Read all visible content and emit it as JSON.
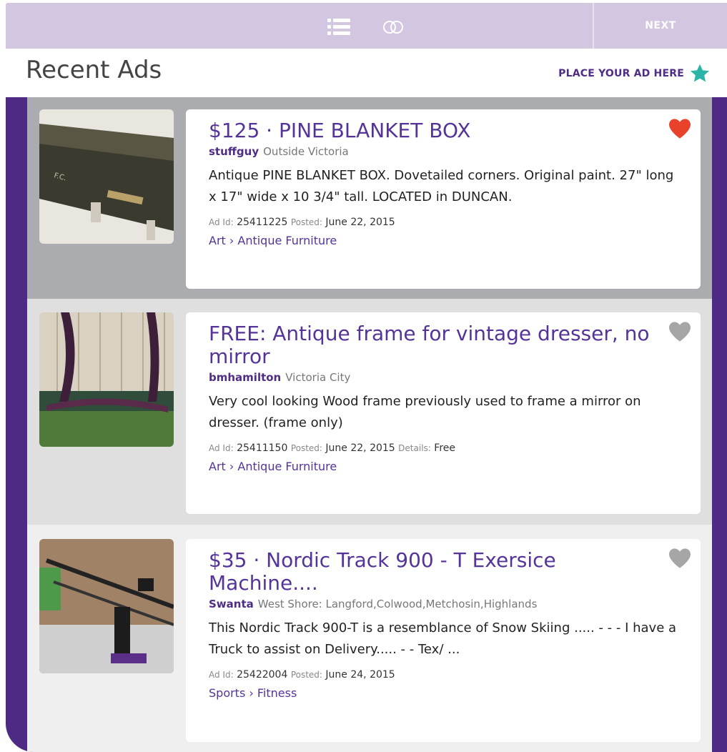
{
  "toolbar": {
    "list_icon": "list-icon",
    "toggle_icon": "toggle-icon",
    "next_label": "NEXT"
  },
  "header": {
    "title": "Recent Ads",
    "place_ad_label": "PLACE YOUR AD HERE",
    "place_ad_icon": "star-icon",
    "accent": "#2bb5a6"
  },
  "colors": {
    "brand": "#4e2a84",
    "title": "#553499",
    "favorite_active": "#e8432a",
    "favorite_inactive": "#a6a6a6"
  },
  "ads": [
    {
      "title": "$125 · PINE BLANKET BOX",
      "user": "stuffguy",
      "location": "Outside Victoria",
      "description": "Antique PINE BLANKET BOX. Dovetailed corners. Original paint. 27\" long x 17\" wide x 10 3/4\" tall. LOCATED in DUNCAN.",
      "ad_id_label": "Ad Id:",
      "ad_id": "25411225",
      "posted_label": "Posted:",
      "posted": "June 22, 2015",
      "details_label": "",
      "details": "",
      "category": "Art › Antique Furniture",
      "favorited": true
    },
    {
      "title": "FREE: Antique frame for vintage dresser, no mirror",
      "user": "bmhamilton",
      "location": "Victoria City",
      "description": "Very cool looking Wood frame previously used to frame a mirror on dresser. (frame only)",
      "ad_id_label": "Ad Id:",
      "ad_id": "25411150",
      "posted_label": "Posted:",
      "posted": "June 22, 2015",
      "details_label": "Details:",
      "details": "Free",
      "category": "Art › Antique Furniture",
      "favorited": false
    },
    {
      "title": "$35 · Nordic Track 900 - T Exersice Machine....",
      "user": "Swanta",
      "location": "West Shore: Langford,Colwood,Metchosin,Highlands",
      "description": "This Nordic Track 900-T is a resemblance of Snow Skiing ..... - - - I have a Truck to assist on Delivery..... - - Tex/ ...",
      "ad_id_label": "Ad Id:",
      "ad_id": "25422004",
      "posted_label": "Posted:",
      "posted": "June 24, 2015",
      "details_label": "",
      "details": "",
      "category": "Sports › Fitness",
      "favorited": false
    }
  ]
}
